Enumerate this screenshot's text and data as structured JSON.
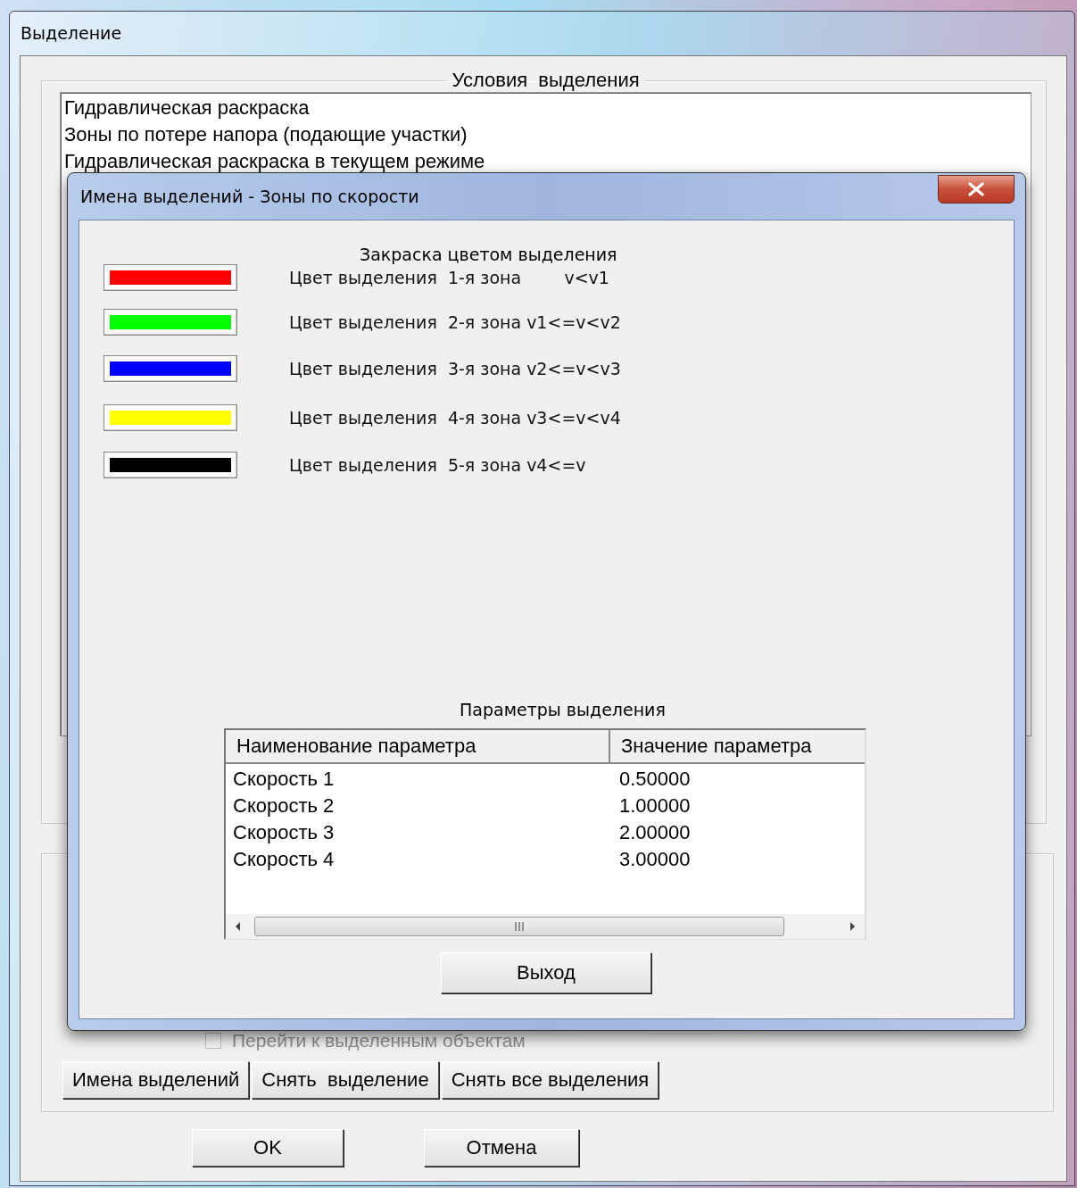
{
  "window": {
    "title": "Выделение"
  },
  "conditions": {
    "title": "Условия  выделения",
    "items": [
      "Гидравлическая раскраска",
      "Зоны по потере напора (подающие участки)",
      "Гидравлическая раскраска в текущем режиме"
    ]
  },
  "goto_checkbox": {
    "label": "Перейти к выделенным объектам",
    "checked": false,
    "disabled": true
  },
  "actions": [
    "Имена выделений",
    "Снять  выделение",
    "Снять все выделения"
  ],
  "footer_buttons": [
    "OK",
    "Отмена"
  ],
  "dialog": {
    "title": "Имена выделений - Зоны по скорости",
    "coloring": {
      "title": "Закраска цветом выделения",
      "zones": [
        {
          "color": "#ff0000",
          "label": "Цвет выделения  1-я зона        v<v1"
        },
        {
          "color": "#00ff00",
          "label": "Цвет выделения  2-я зона v1<=v<v2"
        },
        {
          "color": "#0000ff",
          "label": "Цвет выделения  3-я зона v2<=v<v3"
        },
        {
          "color": "#ffff00",
          "label": "Цвет выделения  4-я зона v3<=v<v4"
        },
        {
          "color": "#000000",
          "label": "Цвет выделения  5-я зона v4<=v"
        }
      ]
    },
    "params": {
      "title": "Параметры выделения",
      "columns": [
        "Наименование параметра",
        "Значение параметра"
      ],
      "rows": [
        [
          "Скорость 1",
          "0.50000"
        ],
        [
          "Скорость 2",
          "1.00000"
        ],
        [
          "Скорость 3",
          "2.00000"
        ],
        [
          "Скорость 4",
          "3.00000"
        ]
      ]
    },
    "exit_button": "Выход"
  }
}
